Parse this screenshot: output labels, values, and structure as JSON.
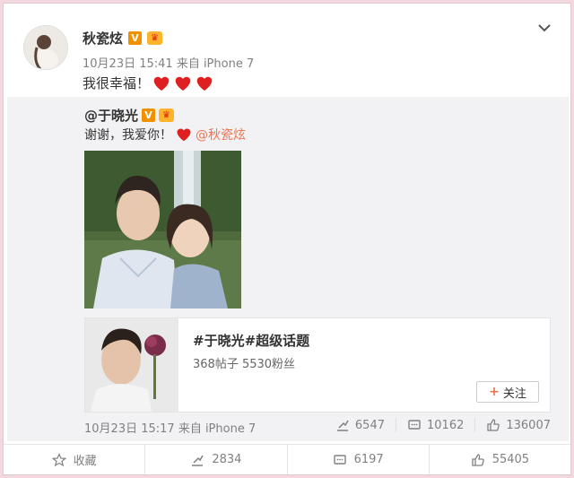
{
  "post": {
    "author": "秋瓷炫",
    "v_badge": "V",
    "meta": "10月23日 15:41 来自 iPhone 7",
    "text": "我很幸福！"
  },
  "repost": {
    "author": "@于晓光",
    "text": "谢谢，我爱你！",
    "mention": "@秋瓷炫",
    "topic": {
      "title": "#于晓光#超级话题",
      "stats": "368帖子 5530粉丝",
      "follow_label": "关注"
    },
    "meta": "10月23日 15:17 来自 iPhone 7",
    "repost_count": "6547",
    "comment_count": "10162",
    "like_count": "136007"
  },
  "actions": {
    "favorite_label": "收藏",
    "repost_count": "2834",
    "comment_count": "6197",
    "like_count": "55405"
  },
  "colors": {
    "accent": "#eb7350",
    "badge": "#f29100",
    "meta_text": "#808080",
    "repost_bg": "#f2f2f5"
  }
}
